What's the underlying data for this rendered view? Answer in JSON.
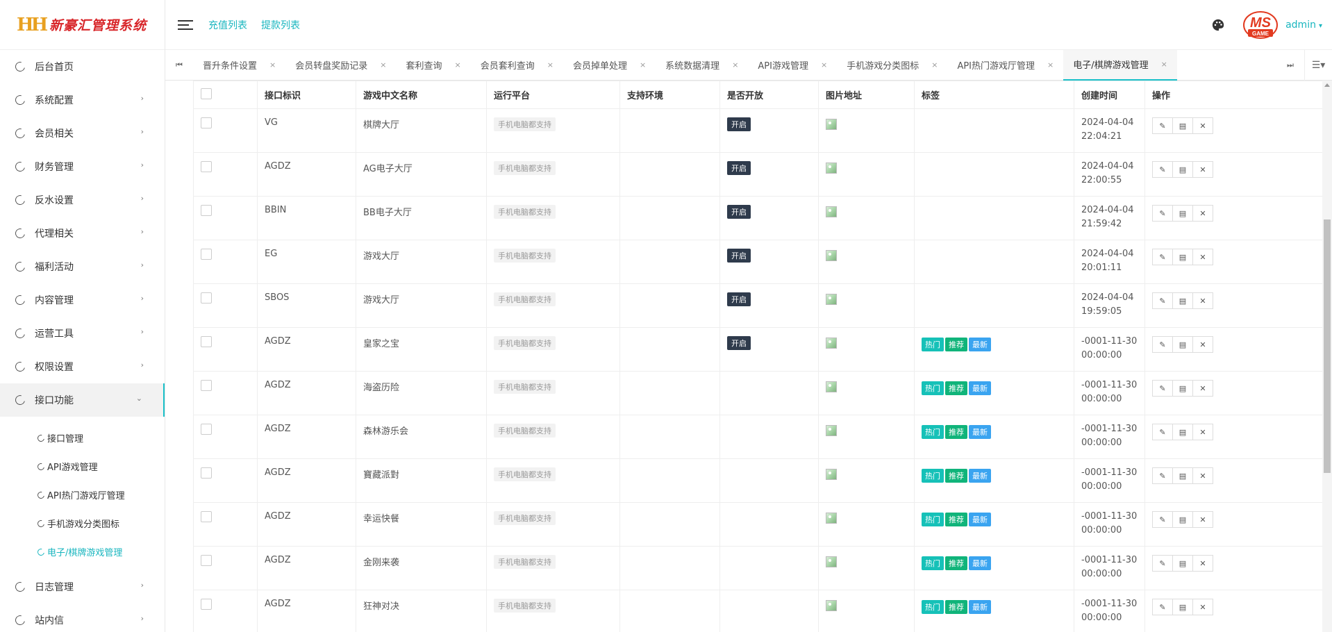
{
  "app": {
    "logo_mark": "HH",
    "logo_text": "新豪汇管理系统"
  },
  "header": {
    "links": [
      "充值列表",
      "提款列表"
    ],
    "user": "admin",
    "brand_logo_text": "MS GAME"
  },
  "sidebar": {
    "items": [
      {
        "label": "后台首页",
        "chevron": false
      },
      {
        "label": "系统配置",
        "chevron": true
      },
      {
        "label": "会员相关",
        "chevron": true
      },
      {
        "label": "财务管理",
        "chevron": true
      },
      {
        "label": "反水设置",
        "chevron": true
      },
      {
        "label": "代理相关",
        "chevron": true
      },
      {
        "label": "福利活动",
        "chevron": true
      },
      {
        "label": "内容管理",
        "chevron": true
      },
      {
        "label": "运营工具",
        "chevron": true
      },
      {
        "label": "权限设置",
        "chevron": true
      },
      {
        "label": "接口功能",
        "chevron": true,
        "open": true
      }
    ],
    "submenu": [
      {
        "label": "接口管理"
      },
      {
        "label": "API游戏管理"
      },
      {
        "label": "API热门游戏厅管理"
      },
      {
        "label": "手机游戏分类图标"
      },
      {
        "label": "电子/棋牌游戏管理",
        "active": true
      }
    ],
    "bottom_items": [
      {
        "label": "日志管理"
      },
      {
        "label": "站内信"
      }
    ]
  },
  "tabs": [
    {
      "label": "晋升条件设置"
    },
    {
      "label": "会员转盘奖励记录"
    },
    {
      "label": "套利查询"
    },
    {
      "label": "会员套利查询"
    },
    {
      "label": "会员掉单处理"
    },
    {
      "label": "系统数据清理"
    },
    {
      "label": "API游戏管理"
    },
    {
      "label": "手机游戏分类图标"
    },
    {
      "label": "API热门游戏厅管理"
    },
    {
      "label": "电子/棋牌游戏管理",
      "active": true
    }
  ],
  "table": {
    "columns": [
      "",
      "接口标识",
      "游戏中文名称",
      "运行平台",
      "支持环境",
      "是否开放",
      "图片地址",
      "标签",
      "创建时间",
      "操作"
    ],
    "platform_label": "手机电脑都支持",
    "open_label": "开启",
    "tag_labels": {
      "hot": "热门",
      "rec": "推荐",
      "new": "最新"
    },
    "rows": [
      {
        "code": "VG",
        "name": "棋牌大厅",
        "open": true,
        "tags": false,
        "date": "2024-04-04",
        "time": "22:04:21"
      },
      {
        "code": "AGDZ",
        "name": "AG电子大厅",
        "open": true,
        "tags": false,
        "date": "2024-04-04",
        "time": "22:00:55"
      },
      {
        "code": "BBIN",
        "name": "BB电子大厅",
        "open": true,
        "tags": false,
        "date": "2024-04-04",
        "time": "21:59:42"
      },
      {
        "code": "EG",
        "name": "游戏大厅",
        "open": true,
        "tags": false,
        "date": "2024-04-04",
        "time": "20:01:11"
      },
      {
        "code": "SBOS",
        "name": "游戏大厅",
        "open": true,
        "tags": false,
        "date": "2024-04-04",
        "time": "19:59:05"
      },
      {
        "code": "AGDZ",
        "name": "皇家之宝",
        "open": true,
        "tags": true,
        "date": "-0001-11-30",
        "time": "00:00:00"
      },
      {
        "code": "AGDZ",
        "name": "海盗历险",
        "open": false,
        "tags": true,
        "date": "-0001-11-30",
        "time": "00:00:00"
      },
      {
        "code": "AGDZ",
        "name": "森林游乐会",
        "open": false,
        "tags": true,
        "date": "-0001-11-30",
        "time": "00:00:00"
      },
      {
        "code": "AGDZ",
        "name": "寶藏派對",
        "open": false,
        "tags": true,
        "date": "-0001-11-30",
        "time": "00:00:00"
      },
      {
        "code": "AGDZ",
        "name": "幸运快餐",
        "open": false,
        "tags": true,
        "date": "-0001-11-30",
        "time": "00:00:00"
      },
      {
        "code": "AGDZ",
        "name": "金刚来袭",
        "open": false,
        "tags": true,
        "date": "-0001-11-30",
        "time": "00:00:00"
      },
      {
        "code": "AGDZ",
        "name": "狂神对决",
        "open": false,
        "tags": true,
        "date": "-0001-11-30",
        "time": "00:00:00"
      }
    ]
  },
  "colors": {
    "accent": "#19c0c9",
    "brand_red": "#d8262a",
    "badge_dark": "#2f3b4c",
    "tag_hot": "#16c1b8",
    "tag_rec": "#10b47a",
    "tag_new": "#3aa4f0"
  },
  "icons": {
    "menu_icon": "circle-arc-icon",
    "hamburger": "hamburger-icon",
    "theme": "palette-icon",
    "ops": [
      "edit-icon",
      "document-icon",
      "close-icon"
    ]
  }
}
